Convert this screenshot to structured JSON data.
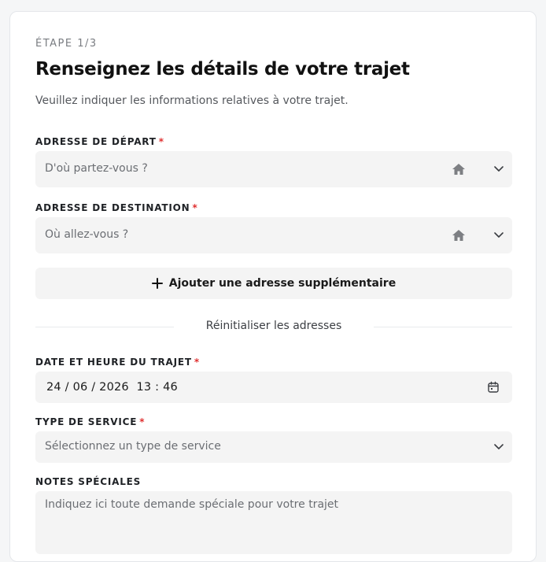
{
  "form": {
    "step": "ÉTAPE 1/3",
    "title": "Renseignez les détails de votre trajet",
    "subtitle": "Veuillez indiquer les informations relatives à votre trajet.",
    "required_marker": "*",
    "departure": {
      "label": "ADRESSE DE DÉPART",
      "placeholder": "D'où partez-vous ?",
      "icon": "home-icon"
    },
    "destination": {
      "label": "ADRESSE DE DESTINATION",
      "placeholder": "Où allez-vous ?",
      "icon": "home-icon"
    },
    "add_address_label": "Ajouter une adresse supplémentaire",
    "reset_label": "Réinitialiser les adresses",
    "datetime": {
      "label": "DATE ET HEURE DU TRAJET",
      "day": "24",
      "month": "06",
      "year": "2026",
      "hour": "13",
      "minute": "46",
      "icon": "calendar-icon"
    },
    "service": {
      "label": "TYPE DE SERVICE",
      "placeholder": "Sélectionnez un type de service"
    },
    "notes": {
      "label": "NOTES SPÉCIALES",
      "placeholder": "Indiquez ici toute demande spéciale pour votre trajet"
    }
  },
  "colors": {
    "required": "#e03131",
    "field_bg": "#f4f4f4",
    "icon": "#7d7f83"
  }
}
